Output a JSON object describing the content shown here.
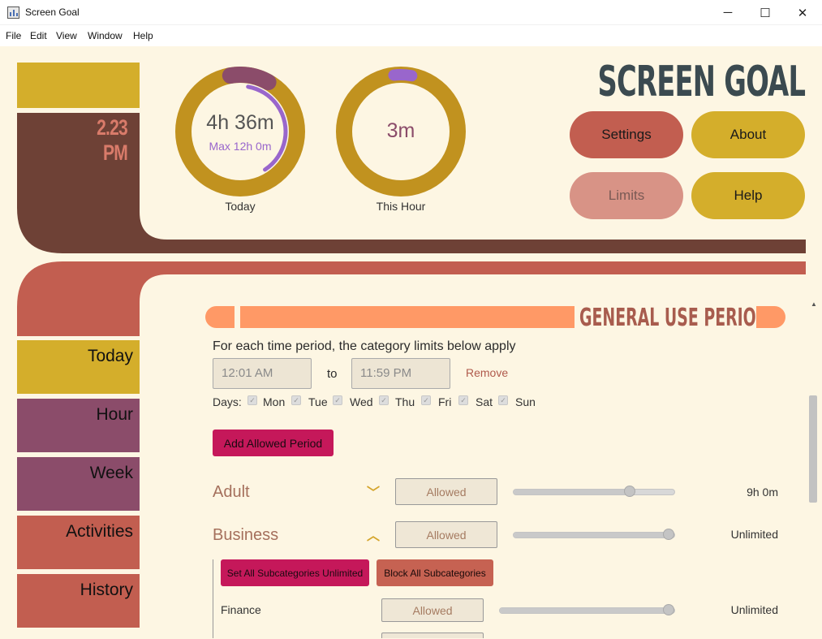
{
  "window": {
    "title": "Screen Goal",
    "minimize": "─",
    "maximize": "☐",
    "close": "✕"
  },
  "menu": [
    "File",
    "Edit",
    "View",
    "Window",
    "Help"
  ],
  "clock": "2.23 PM",
  "brand": "SCREEN GOAL",
  "today_ring": {
    "value": "4h 36m",
    "max": "Max 12h 0m",
    "label": "Today",
    "progress": 0.38
  },
  "hour_ring": {
    "value": "3m",
    "label": "This Hour",
    "progress": 0.05
  },
  "buttons": {
    "settings": "Settings",
    "about": "About",
    "limits": "Limits",
    "help": "Help"
  },
  "nav": [
    "Today",
    "Hour",
    "Week",
    "Activities",
    "History"
  ],
  "section_title": "GENERAL USE PERIODS",
  "period": {
    "intro": "For each time period, the category limits below apply",
    "from": "12:01 AM",
    "to_label": "to",
    "to": "11:59 PM",
    "remove": "Remove",
    "days_label": "Days:",
    "days": [
      "Mon",
      "Tue",
      "Wed",
      "Thu",
      "Fri",
      "Sat",
      "Sun"
    ]
  },
  "add_period": "Add Allowed Period",
  "categories": [
    {
      "name": "Adult",
      "status": "Allowed",
      "limit": "9h 0m",
      "level": 0.74,
      "expanded": false
    },
    {
      "name": "Business",
      "status": "Allowed",
      "limit": "Unlimited",
      "level": 1.0,
      "expanded": true
    }
  ],
  "sub_actions": {
    "unlimited": "Set All Subcategories Unlimited",
    "block": "Block All Subcategories"
  },
  "subcategories": [
    {
      "name": "Finance",
      "status": "Allowed",
      "limit": "Unlimited",
      "level": 1.0
    }
  ],
  "colors": {
    "gold": "#d4ae2b",
    "brown": "#6e4136",
    "rust": "#c25e50",
    "plum": "#8b4c6a",
    "peach": "#ff9966",
    "magenta": "#c5185a",
    "ring_gold": "#c1921f",
    "ring_purple": "#9966cc"
  }
}
